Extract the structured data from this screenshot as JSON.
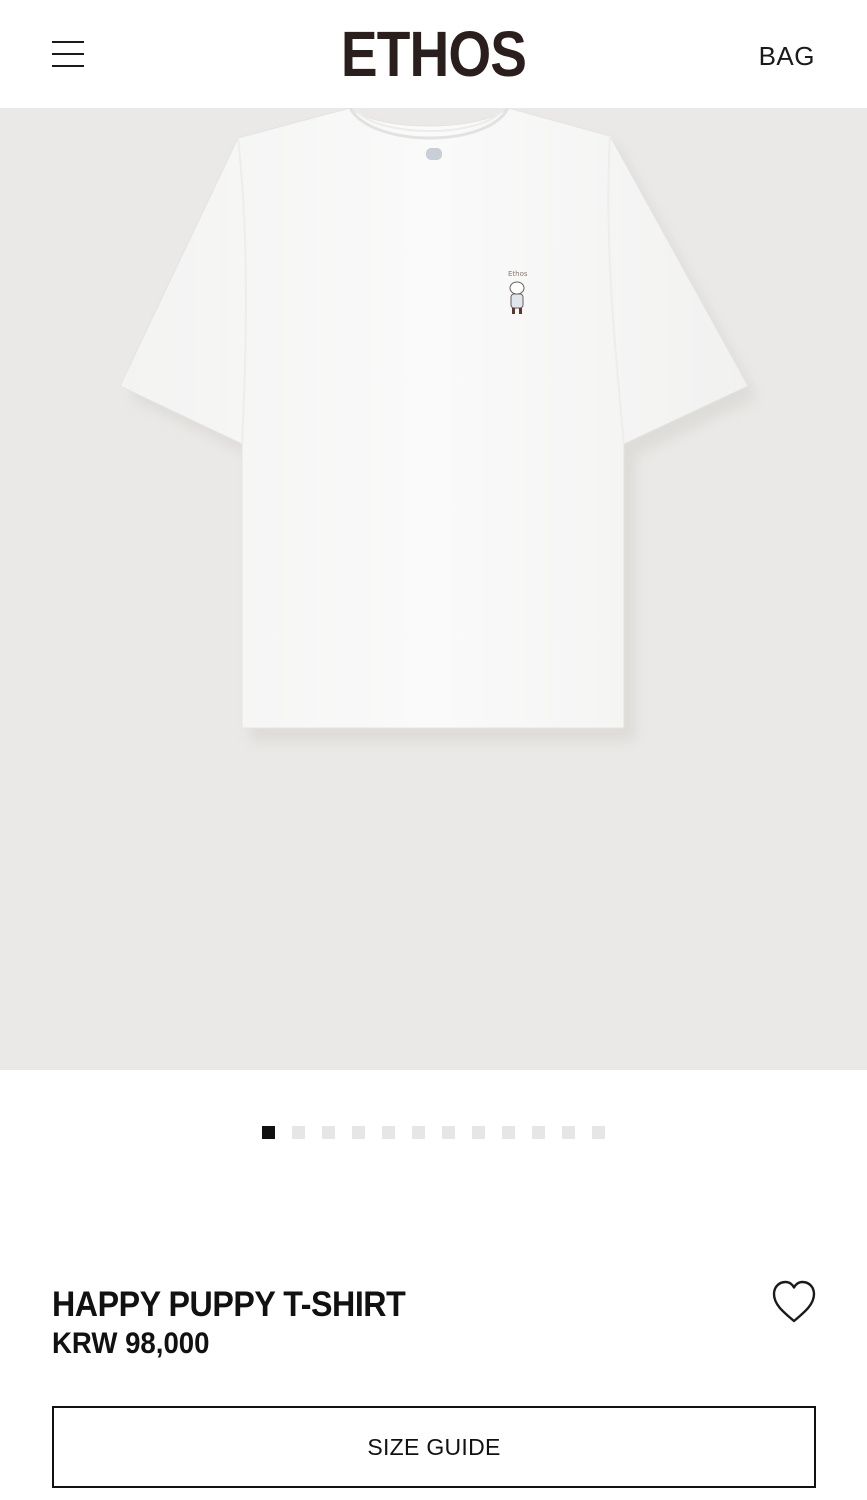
{
  "header": {
    "menu_icon": "hamburger-menu-icon",
    "logo": "ETHOS",
    "bag_label": "BAG"
  },
  "gallery": {
    "image_subject": "white t-shirt",
    "total_images": 12,
    "current_index": 1,
    "background_color": "#ebe9e7"
  },
  "product": {
    "name": "HAPPY PUPPY T-SHIRT",
    "price": "KRW 98,000",
    "wishlist_icon": "heart-outline-icon"
  },
  "actions": {
    "size_guide_label": "SIZE GUIDE"
  },
  "colors": {
    "text": "#111111",
    "logo": "#2a1f1c",
    "dot_active": "#111111",
    "dot_inactive": "#e6e6e6"
  }
}
